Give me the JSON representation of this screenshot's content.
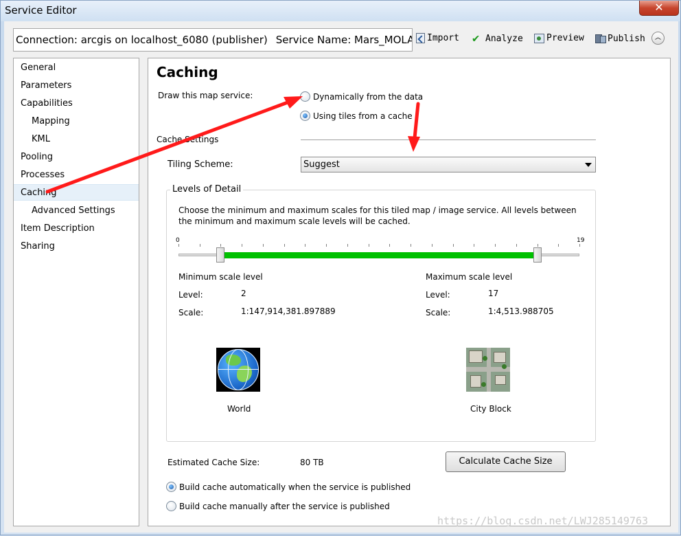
{
  "window": {
    "title": "Service Editor",
    "close_label": "✕"
  },
  "toolbar": {
    "connection_text": "Connection: arcgis on localhost_6080 (publisher)",
    "service_name_text": "Service Name: Mars_MOLA...",
    "import_label": "Import",
    "analyze_label": "Analyze",
    "preview_label": "Preview",
    "publish_label": "Publish",
    "collapse_label": "︿"
  },
  "sidebar": {
    "items": [
      {
        "label": "General"
      },
      {
        "label": "Parameters"
      },
      {
        "label": "Capabilities"
      },
      {
        "label": "Mapping"
      },
      {
        "label": "KML"
      },
      {
        "label": "Pooling"
      },
      {
        "label": "Processes"
      },
      {
        "label": "Caching"
      },
      {
        "label": "Advanced Settings"
      },
      {
        "label": "Item Description"
      },
      {
        "label": "Sharing"
      }
    ],
    "active": "Caching"
  },
  "caching": {
    "title": "Caching",
    "draw_label": "Draw this map service:",
    "option_dynamic": "Dynamically from the data",
    "option_tiles": "Using tiles from a cache",
    "selected_option": "tiles",
    "cache_settings_label": "Cache Settings",
    "tiling_scheme_label": "Tiling Scheme:",
    "tiling_scheme_value": "Suggest",
    "lod": {
      "legend": "Levels of Detail",
      "description": "Choose the minimum and maximum scales for this tiled map / image service. All levels between the minimum and maximum scale levels will be cached.",
      "slider_min_label": "0",
      "slider_max_label": "19",
      "slider_range": [
        0,
        19
      ],
      "min_level": 2,
      "max_level": 17,
      "minimum_heading": "Minimum scale level",
      "maximum_heading": "Maximum scale level",
      "level_label": "Level:",
      "scale_label": "Scale:",
      "min_level_value": "2",
      "min_scale_value": "1:147,914,381.897889",
      "max_level_value": "17",
      "max_scale_value": "1:4,513.988705",
      "world_label": "World",
      "city_label": "City Block"
    },
    "estimated_label": "Estimated Cache Size:",
    "estimated_value": "80 TB",
    "calculate_button": "Calculate Cache Size",
    "build_auto": "Build cache automatically when the service is published",
    "build_manual": "Build cache manually after the service is published",
    "build_selected": "auto"
  },
  "watermark": "https://blog.csdn.net/LWJ285149763",
  "colors": {
    "slider_fill": "#00c000",
    "annotation_arrow": "#ff1a1a"
  }
}
